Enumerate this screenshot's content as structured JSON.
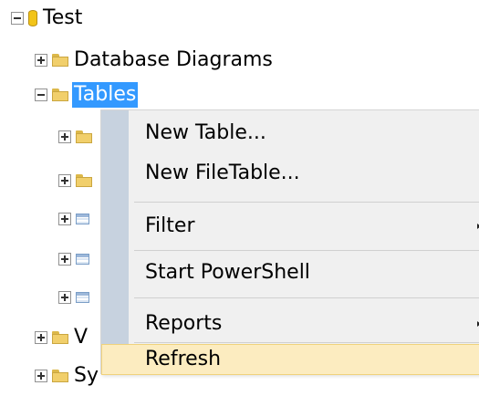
{
  "tree": {
    "root": {
      "label": "Test",
      "icon": "database-icon",
      "expanded": true
    },
    "items": [
      {
        "label": "Database Diagrams",
        "icon": "folder-icon",
        "expanded": false
      },
      {
        "label": "Tables",
        "icon": "folder-icon",
        "expanded": true,
        "selected": true
      },
      {
        "label": "V",
        "icon": "folder-icon",
        "expanded": false
      },
      {
        "label": "Sy",
        "icon": "folder-icon",
        "expanded": false
      }
    ]
  },
  "context_menu": {
    "items": [
      {
        "label": "New Table..."
      },
      {
        "label": "New FileTable..."
      },
      {
        "label": "Filter",
        "submenu": true
      },
      {
        "label": "Start PowerShell"
      },
      {
        "label": "Reports",
        "submenu": true
      },
      {
        "label": "Refresh",
        "highlighted": true
      }
    ]
  },
  "colors": {
    "selection": "#3399ff",
    "menu_highlight": "#fcecc0",
    "menu_gutter": "#c7d2df"
  }
}
